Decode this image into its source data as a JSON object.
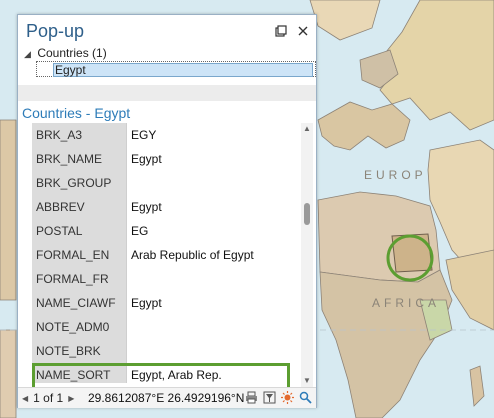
{
  "map": {
    "labels": {
      "europe": "EUROP",
      "africa": "AFRICA"
    }
  },
  "popup": {
    "title": "Pop-up",
    "window_buttons": {
      "restore_icon": "restore-icon",
      "close_icon": "close-icon"
    },
    "tree": {
      "group_label": "Countries (1)",
      "selected_item": "Egypt"
    },
    "section_title": "Countries - Egypt",
    "attributes": [
      {
        "name": "BRK_A3",
        "value": "EGY"
      },
      {
        "name": "BRK_NAME",
        "value": "Egypt"
      },
      {
        "name": "BRK_GROUP",
        "value": ""
      },
      {
        "name": "ABBREV",
        "value": "Egypt"
      },
      {
        "name": "POSTAL",
        "value": "EG"
      },
      {
        "name": "FORMAL_EN",
        "value": "Arab Republic of Egypt"
      },
      {
        "name": "FORMAL_FR",
        "value": ""
      },
      {
        "name": "NAME_CIAWF",
        "value": "Egypt"
      },
      {
        "name": "NOTE_ADM0",
        "value": ""
      },
      {
        "name": "NOTE_BRK",
        "value": ""
      },
      {
        "name": "NAME_SORT",
        "value": "Egypt, Arab Rep."
      }
    ],
    "highlighted_attribute": "NAME_SORT",
    "highlight_color": "#5c9e31",
    "footer": {
      "pager_text": "1 of 1",
      "coordinates": "29.8612087°E 26.4929196°N",
      "tool_icons": [
        "print-icon",
        "filter-icon",
        "flash-icon",
        "zoom-to-icon"
      ]
    }
  }
}
